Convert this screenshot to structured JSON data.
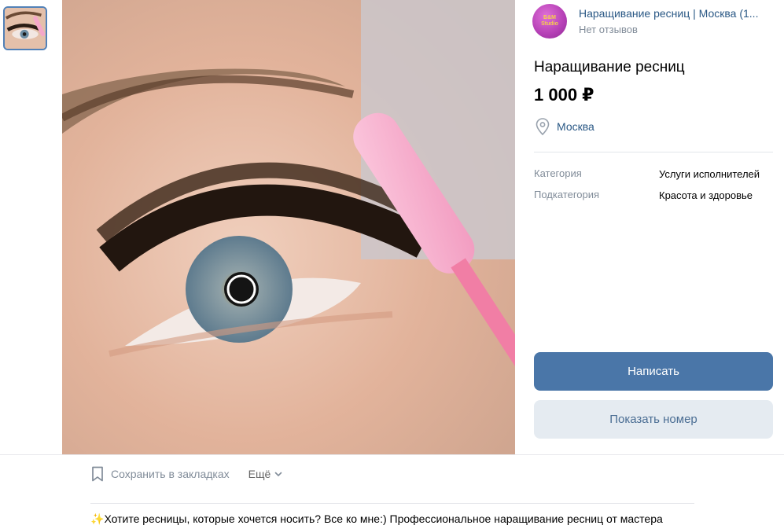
{
  "seller": {
    "name": "Наращивание ресниц | Москва (1...",
    "reviews": "Нет отзывов",
    "avatar_lines": [
      "Б&М",
      "Studio"
    ]
  },
  "item": {
    "title": "Наращивание ресниц",
    "price": "1 000 ₽",
    "location": "Москва"
  },
  "properties": [
    {
      "key": "Категория",
      "value": "Услуги исполнителей"
    },
    {
      "key": "Подкатегория",
      "value": "Красота и здоровье"
    }
  ],
  "buttons": {
    "write": "Написать",
    "show_phone": "Показать номер"
  },
  "actions": {
    "bookmark": "Сохранить в закладках",
    "more": "Ещё"
  },
  "description": {
    "emoji": "✨",
    "text": "Хотите ресницы, которые хочется носить? Все ко мне:) Профессиональное наращивание ресниц от мастера"
  },
  "colors": {
    "accent": "#4a76a8",
    "link": "#2a5885",
    "secondary_button": "#e5ebf1",
    "muted_text": "#818c99"
  }
}
